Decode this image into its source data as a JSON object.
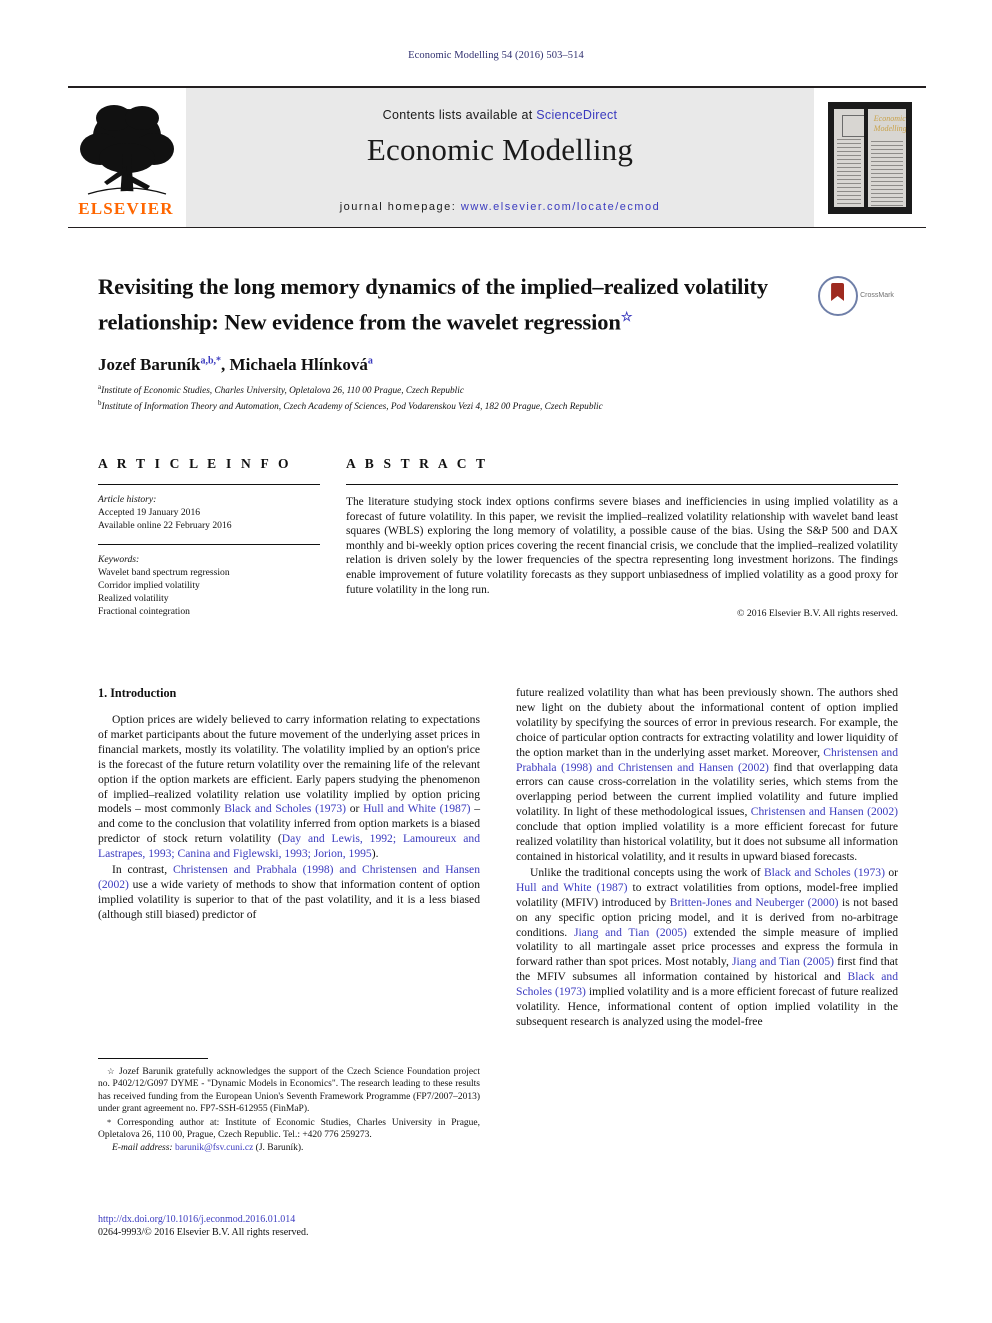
{
  "running_head": "Economic Modelling 54 (2016) 503–514",
  "masthead": {
    "contents_prefix": "Contents lists available at",
    "contents_link": "ScienceDirect",
    "journal_title": "Economic Modelling",
    "homepage_label": "journal homepage:",
    "homepage_url": "www.elsevier.com/locate/ecmod",
    "publisher": "ELSEVIER",
    "cover_title_line1": "Economic",
    "cover_title_line2": "Modelling"
  },
  "article": {
    "title": "Revisiting the long memory dynamics of the implied–realized volatility relationship: New evidence from the wavelet regression",
    "title_star": "☆",
    "crossmark_label": "CrossMark",
    "authors_html": "Jozef Baruník",
    "author1": "Jozef Baruník",
    "author1_sup": "a,b,*",
    "author2": "Michaela Hlínková",
    "author2_sup": "a",
    "affiliation_a_sup": "a",
    "affiliation_a": "Institute of Economic Studies, Charles University, Opletalova 26, 110 00 Prague, Czech Republic",
    "affiliation_b_sup": "b",
    "affiliation_b": "Institute of Information Theory and Automation, Czech Academy of Sciences, Pod Vodarenskou Vezi 4, 182 00 Prague, Czech Republic"
  },
  "info": {
    "heading": "A R T I C L E    I N F O",
    "history_label": "Article history:",
    "history_items": [
      "Accepted 19 January 2016",
      "Available online 22 February 2016"
    ],
    "keywords_label": "Keywords:",
    "keywords": [
      "Wavelet band spectrum regression",
      "Corridor implied volatility",
      "Realized volatility",
      "Fractional cointegration"
    ]
  },
  "abstract": {
    "heading": "A B S T R A C T",
    "text": "The literature studying stock index options confirms severe biases and inefficiencies in using implied volatility as a forecast of future volatility. In this paper, we revisit the implied–realized volatility relationship with wavelet band least squares (WBLS) exploring the long memory of volatility, a possible cause of the bias. Using the S&P 500 and DAX monthly and bi-weekly option prices covering the recent financial crisis, we conclude that the implied–realized volatility relation is driven solely by the lower frequencies of the spectra representing long investment horizons. The findings enable improvement of future volatility forecasts as they support unbiasedness of implied volatility as a good proxy for future volatility in the long run.",
    "copyright": "© 2016 Elsevier B.V. All rights reserved."
  },
  "body": {
    "section_heading": "1.  Introduction",
    "left_paragraphs": [
      {
        "parts": [
          {
            "t": "Option prices are widely believed to carry information relating to expectations of market participants about the future movement of the underlying asset prices in financial markets, mostly its volatility. The volatility implied by an option's price is the forecast of the future return volatility over the remaining life of the relevant option if the option markets are efficient. Early papers studying the phenomenon of implied–realized volatility relation use volatility implied by option pricing models – most commonly ",
            "r": false
          },
          {
            "t": "Black and Scholes (1973)",
            "r": true
          },
          {
            "t": " or ",
            "r": false
          },
          {
            "t": "Hull and White (1987)",
            "r": true
          },
          {
            "t": " – and come to the conclusion that volatility inferred from option markets is a biased predictor of stock return volatility (",
            "r": false
          },
          {
            "t": "Day and Lewis, 1992; Lamoureux and Lastrapes, 1993; Canina and Figlewski, 1993; Jorion, 1995",
            "r": true
          },
          {
            "t": ").",
            "r": false
          }
        ]
      },
      {
        "parts": [
          {
            "t": "In contrast, ",
            "r": false
          },
          {
            "t": "Christensen and Prabhala (1998) and Christensen and Hansen (2002)",
            "r": true
          },
          {
            "t": " use a wide variety of methods to show that information content of option implied volatility is superior to that of the past volatility, and it is a less biased (although still biased) predictor of",
            "r": false
          }
        ]
      }
    ],
    "right_paragraphs": [
      {
        "parts": [
          {
            "t": "future realized volatility than what has been previously shown. The authors shed new light on the dubiety about the informational content of option implied volatility by specifying the sources of error in previous research. For example, the choice of particular option contracts for extracting volatility and lower liquidity of the option market than in the underlying asset market. Moreover, ",
            "r": false
          },
          {
            "t": "Christensen and Prabhala (1998) and Christensen and Hansen (2002)",
            "r": true
          },
          {
            "t": " find that overlapping data errors can cause cross-correlation in the volatility series, which stems from the overlapping period between the current implied volatility and future implied volatility. In light of these methodological issues, ",
            "r": false
          },
          {
            "t": "Christensen and Hansen (2002)",
            "r": true
          },
          {
            "t": " conclude that option implied volatility is a more efficient forecast for future realized volatility than historical volatility, but it does not subsume all information contained in historical volatility, and it results in upward biased forecasts.",
            "r": false
          }
        ]
      },
      {
        "parts": [
          {
            "t": "Unlike the traditional concepts using the work of ",
            "r": false
          },
          {
            "t": "Black and Scholes (1973)",
            "r": true
          },
          {
            "t": " or ",
            "r": false
          },
          {
            "t": "Hull and White (1987)",
            "r": true
          },
          {
            "t": " to extract volatilities from options, model-free implied volatility (MFIV) introduced by ",
            "r": false
          },
          {
            "t": "Britten-Jones and Neuberger (2000)",
            "r": true
          },
          {
            "t": " is not based on any specific option pricing model, and it is derived from no-arbitrage conditions. ",
            "r": false
          },
          {
            "t": "Jiang and Tian (2005)",
            "r": true
          },
          {
            "t": " extended the simple measure of implied volatility to all martingale asset price processes and express the formula in forward rather than spot prices. Most notably, ",
            "r": false
          },
          {
            "t": "Jiang and Tian (2005)",
            "r": true
          },
          {
            "t": " first find that the MFIV subsumes all information contained by historical and ",
            "r": false
          },
          {
            "t": "Black and Scholes (1973)",
            "r": true
          },
          {
            "t": " implied volatility and is a more efficient forecast of future realized volatility. Hence, informational content of option implied volatility in the subsequent research is analyzed using the model-free",
            "r": false
          }
        ]
      }
    ]
  },
  "footnotes": {
    "star_mark": "☆",
    "star_text": "Jozef Barunik gratefully acknowledges the support of the Czech Science Foundation project no. P402/12/G097 DYME - \"Dynamic Models in Economics\". The research leading to these results has received funding from the European Union's Seventh Framework Programme (FP7/2007–2013) under grant agreement no. FP7-SSH-612955 (FinMaP).",
    "star_mark2": "*",
    "corresponding_text": "Corresponding author at: Institute of Economic Studies, Charles University in Prague, Opletalova 26, 110 00, Prague, Czech Republic. Tel.: +420 776 259273.",
    "email_label": "E-mail address:",
    "email": "barunik@fsv.cuni.cz",
    "email_suffix": "(J. Baruník)."
  },
  "footer": {
    "doi": "http://dx.doi.org/10.1016/j.econmod.2016.01.014",
    "issn_line": "0264-9993/© 2016 Elsevier B.V. All rights reserved."
  },
  "colors": {
    "link": "#3b3bbf",
    "elsevier_orange": "#ff6600",
    "masthead_grey": "#e9e9e9"
  }
}
